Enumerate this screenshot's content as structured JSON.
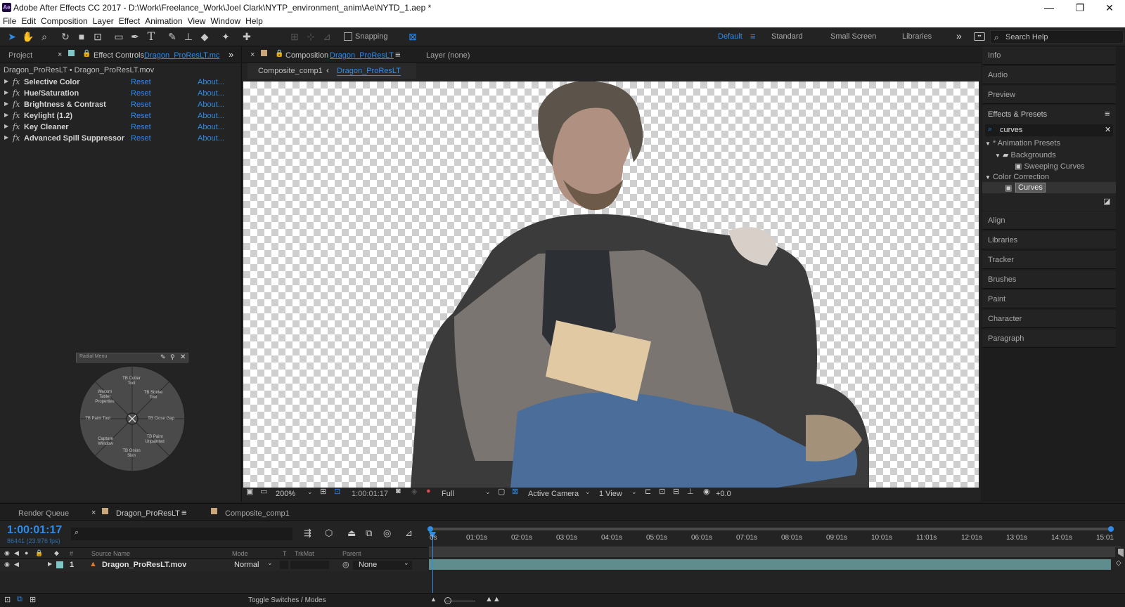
{
  "window": {
    "title": "Adobe After Effects CC 2017 - D:\\Work\\Freelance_Work\\Joel Clark\\NYTP_environment_anim\\Ae\\NYTD_1.aep *",
    "app_logo": "Ae",
    "controls": [
      "—",
      "❐",
      "✕"
    ]
  },
  "menu": [
    "File",
    "Edit",
    "Composition",
    "Layer",
    "Effect",
    "Animation",
    "View",
    "Window",
    "Help"
  ],
  "toolbar": {
    "snapping_label": "Snapping",
    "workspaces": [
      "Default",
      "Standard",
      "Small Screen",
      "Libraries"
    ],
    "active_workspace": "Default",
    "search_placeholder": "Search Help"
  },
  "left_panel": {
    "tab_project": "Project",
    "tab_effect_controls_prefix": "Effect Controls",
    "tab_effect_controls_layer": "Dragon_ProResLT.mc",
    "breadcrumb": "Dragon_ProResLT • Dragon_ProResLT.mov",
    "effects": [
      {
        "name": "Selective Color",
        "reset": "Reset",
        "about": "About..."
      },
      {
        "name": "Hue/Saturation",
        "reset": "Reset",
        "about": "About..."
      },
      {
        "name": "Brightness & Contrast",
        "reset": "Reset",
        "about": "About..."
      },
      {
        "name": "Keylight (1.2)",
        "reset": "Reset",
        "about": "About..."
      },
      {
        "name": "Key Cleaner",
        "reset": "Reset",
        "about": "About..."
      },
      {
        "name": "Advanced Spill Suppressor",
        "reset": "Reset",
        "about": "About..."
      }
    ],
    "radial_menu": {
      "title": "Radial Menu",
      "segments": [
        "TB Cutter Tool",
        "TB Stroke Tool",
        "TB Close Gap",
        "TB Paint Unpainted",
        "TB Onion Skin",
        "Capture Window",
        "TB Paint Tool",
        "Wacom Tablet Properties"
      ]
    }
  },
  "composition_panel": {
    "tab_prefix": "Composition",
    "tab_name": "Dragon_ProResLT",
    "layer_tab": "Layer  (none)",
    "breadcrumbs": [
      "Composite_comp1",
      "Dragon_ProResLT"
    ],
    "zoom": "200%",
    "timecode": "1:00:01:17",
    "resolution": "Full",
    "camera": "Active Camera",
    "views": "1 View",
    "exposure": "+0.0"
  },
  "right_panel": {
    "items_top": [
      "Info",
      "Audio",
      "Preview"
    ],
    "effects_presets_title": "Effects & Presets",
    "search_value": "curves",
    "tree": [
      {
        "label": "* Animation Presets",
        "level": 0
      },
      {
        "label": "Backgrounds",
        "level": 1
      },
      {
        "label": "Sweeping Curves",
        "level": 2
      },
      {
        "label": "Color Correction",
        "level": 0
      },
      {
        "label": "Curves",
        "level": 1
      }
    ],
    "items_bottom": [
      "Align",
      "Libraries",
      "Tracker",
      "Brushes",
      "Paint",
      "Character",
      "Paragraph"
    ]
  },
  "timeline": {
    "tabs": [
      "Render Queue",
      "Dragon_ProResLT",
      "Composite_comp1"
    ],
    "current_time": "1:00:01:17",
    "frame_info": "86441 (23.976 fps)",
    "columns": [
      "#",
      "Source Name",
      "Mode",
      "T",
      "TrkMat",
      "Parent"
    ],
    "ruler": [
      "0s",
      "01:01s",
      "02:01s",
      "03:01s",
      "04:01s",
      "05:01s",
      "06:01s",
      "07:01s",
      "08:01s",
      "09:01s",
      "10:01s",
      "11:01s",
      "12:01s",
      "13:01s",
      "14:01s",
      "15:01"
    ],
    "layers": [
      {
        "index": "1",
        "name": "Dragon_ProResLT.mov",
        "mode": "Normal",
        "parent": "None"
      }
    ],
    "toggle_label": "Toggle Switches / Modes"
  },
  "colors": {
    "accent": "#2d8ceb",
    "panel_bg": "#232323",
    "label_teal": "#5f8c8c"
  }
}
